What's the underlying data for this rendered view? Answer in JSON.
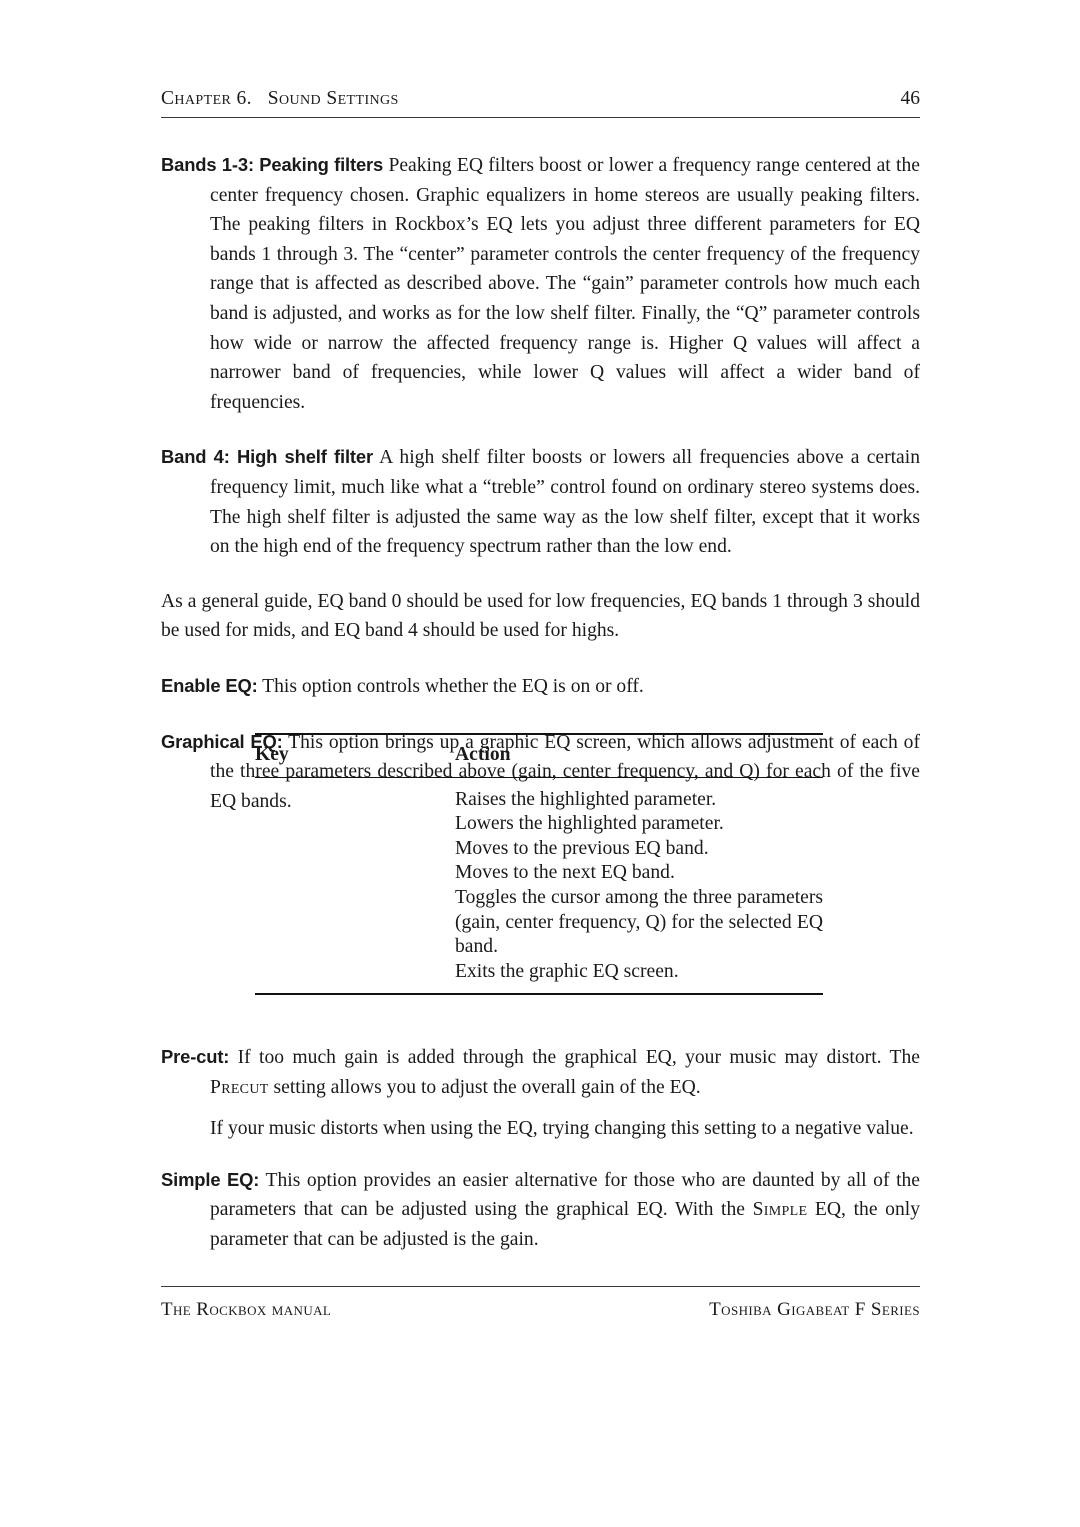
{
  "header": {
    "chapter_label": "Chapter 6.   Sound Settings",
    "page_number": "46"
  },
  "body": {
    "items": [
      {
        "lead": "Bands 1-3: Peaking filters",
        "text": "Peaking EQ filters boost or lower a frequency range centered at the center frequency chosen. Graphic equalizers in home stereos are usually peaking filters. The peaking filters in Rockbox’s EQ lets you adjust three different parameters for EQ bands 1 through 3. The “center” parameter controls the center frequency of the frequency range that is affected as described above. The “gain” parameter controls how much each band is adjusted, and works as for the low shelf filter. Finally, the “Q” parameter controls how wide or narrow the affected frequency range is. Higher Q values will affect a narrower band of frequencies, while lower Q values will affect a wider band of frequencies."
      },
      {
        "lead": "Band 4: High shelf filter",
        "text": "A high shelf filter boosts or lowers all frequencies above a certain frequency limit, much like what a “treble” control found on ordinary stereo systems does. The high shelf filter is adjusted the same way as the low shelf filter, except that it works on the high end of the frequency spectrum rather than the low end."
      }
    ],
    "general_guide": "As a general guide, EQ band 0 should be used for low frequencies, EQ bands 1 through 3 should be used for mids, and EQ band 4 should be used for highs.",
    "enable_eq": {
      "lead": "Enable EQ:",
      "text": "This option controls whether the EQ is on or off."
    },
    "graphical_eq": {
      "lead": "Graphical EQ:",
      "text": "This option brings up a graphic EQ screen, which allows adjustment of each of the three parameters described above (gain, center frequency, and Q) for each of the five EQ bands."
    }
  },
  "key_table": {
    "headers": {
      "key": "Key",
      "action": "Action"
    },
    "rows": [
      {
        "key": "",
        "action": "Raises the highlighted parameter."
      },
      {
        "key": "",
        "action": "Lowers the highlighted parameter."
      },
      {
        "key": "",
        "action": "Moves to the previous EQ band."
      },
      {
        "key": "",
        "action": "Moves to the next EQ band."
      },
      {
        "key": "",
        "action": "Toggles the cursor among the three parameters (gain, center frequency, Q) for the selected EQ band."
      },
      {
        "key": "",
        "action": "Exits the graphic EQ screen."
      }
    ]
  },
  "body_lower": {
    "precut": {
      "lead": "Pre-cut:",
      "text_a": "If too much gain is added through the graphical EQ, your music may distort. The ",
      "smallcaps": "Precut",
      "text_b": " setting allows you to adjust the overall gain of the EQ."
    },
    "precut_note": "If your music distorts when using the EQ, trying changing this setting to a negative value.",
    "simple_eq": {
      "lead": "Simple EQ:",
      "text_a": "This option provides an easier alternative for those who are daunted by all of the parameters that can be adjusted using the graphical EQ. With the ",
      "smallcaps": "Simple",
      "text_b": " EQ, the only parameter that can be adjusted is the gain."
    }
  },
  "footer": {
    "left": "The Rockbox manual",
    "right": "Toshiba Gigabeat F Series"
  }
}
